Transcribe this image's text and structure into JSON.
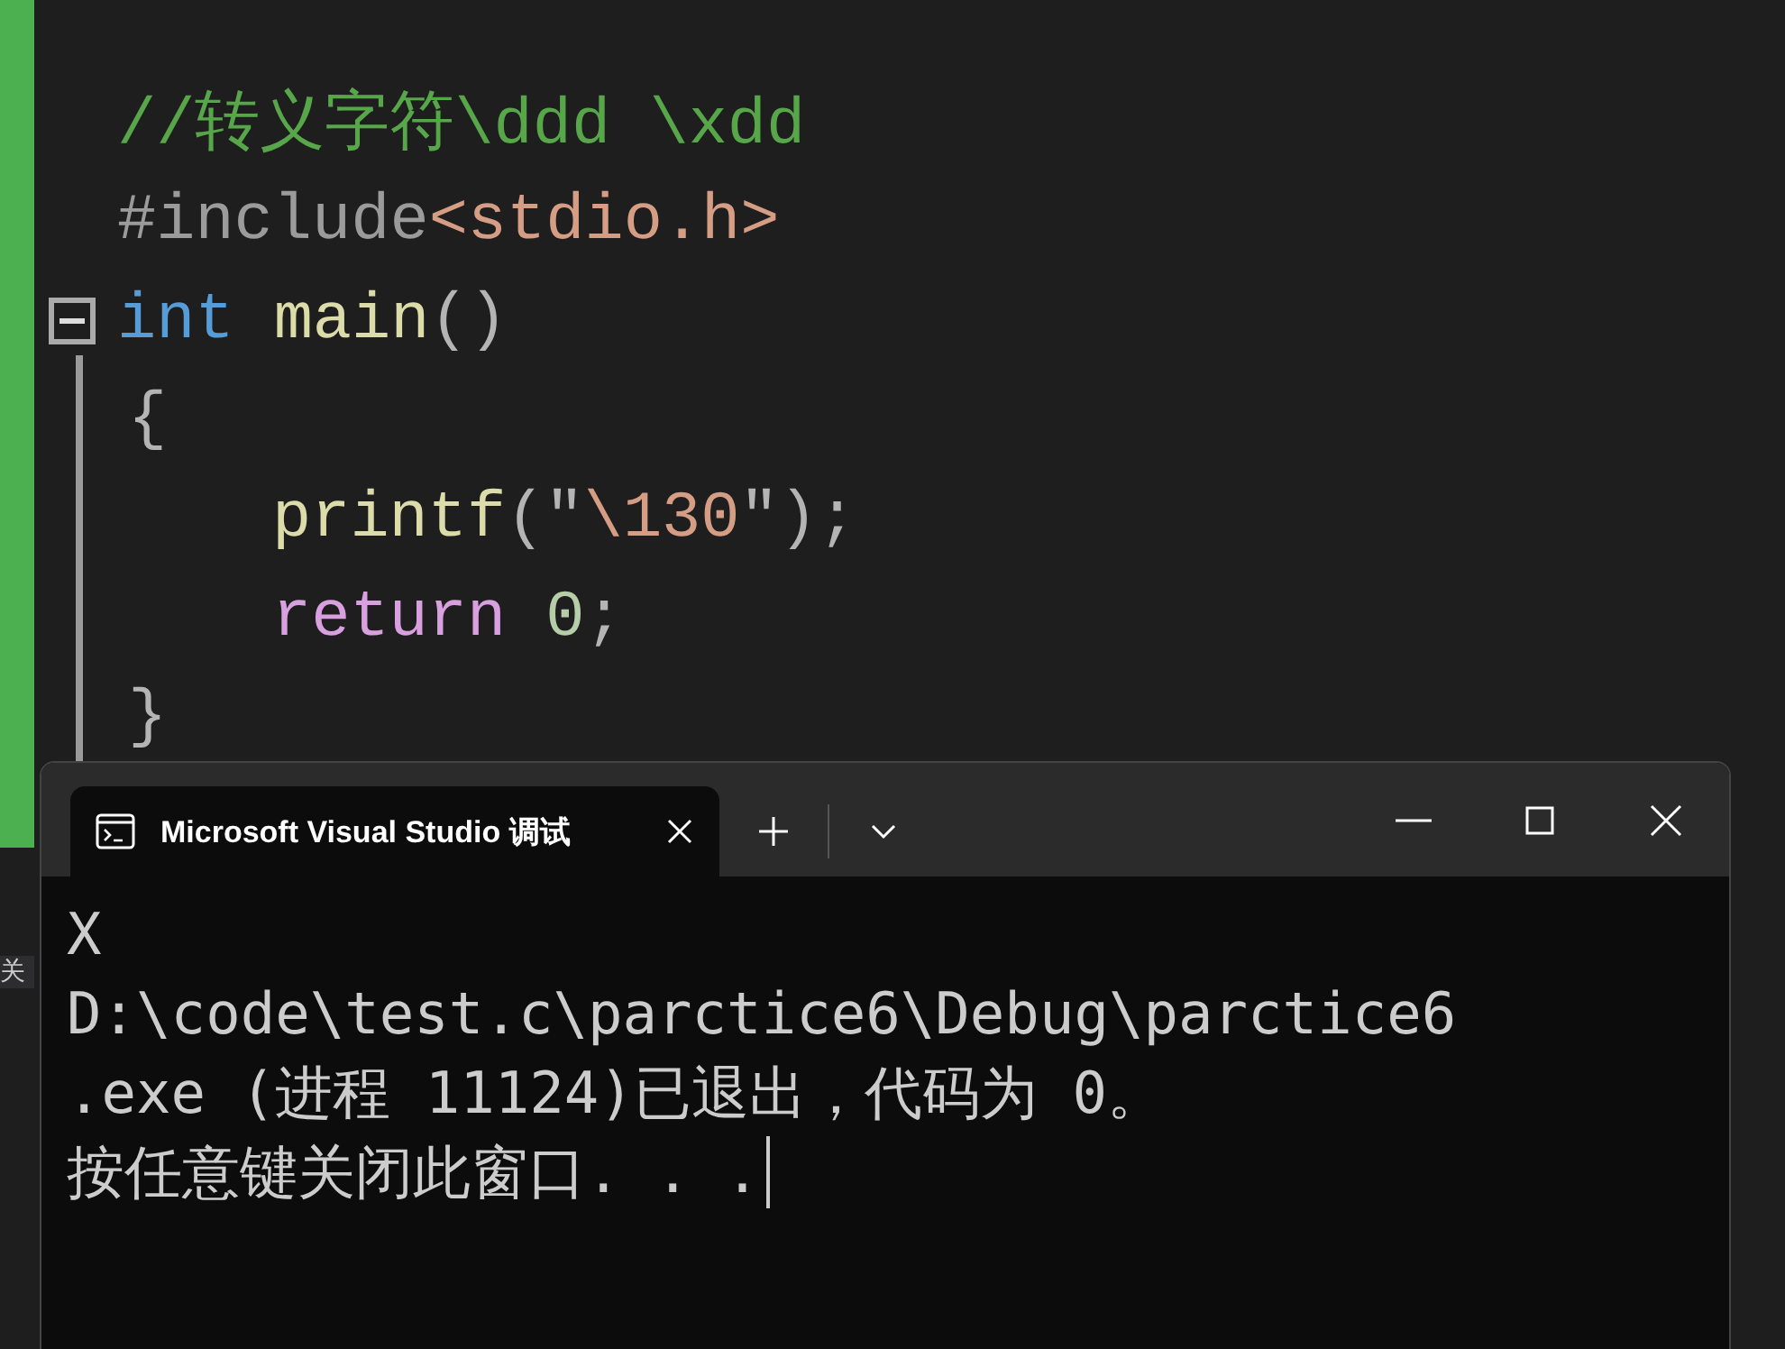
{
  "editor": {
    "lines": [
      {
        "kind": "plain",
        "tokens": [
          {
            "kind": "comment",
            "text": "//转义字符\\ddd \\xdd"
          }
        ]
      },
      {
        "kind": "plain",
        "tokens": [
          {
            "kind": "preproc",
            "text": "#include"
          },
          {
            "kind": "header",
            "text": "<stdio.h>"
          }
        ]
      },
      {
        "kind": "fold",
        "expanded": true,
        "tokens": [
          {
            "kind": "keyword",
            "text": "int"
          },
          {
            "kind": "function",
            "text": "main"
          },
          {
            "kind": "punct",
            "text": "()"
          }
        ]
      },
      {
        "kind": "brace",
        "tokens": [
          {
            "kind": "punct",
            "text": "{"
          }
        ]
      },
      {
        "kind": "body",
        "tokens": [
          {
            "kind": "function",
            "text": "printf"
          },
          {
            "kind": "punct",
            "text": "(\""
          },
          {
            "kind": "string",
            "text": "\\130"
          },
          {
            "kind": "punct",
            "text": "\");"
          }
        ]
      },
      {
        "kind": "body",
        "tokens": [
          {
            "kind": "control",
            "text": "return"
          },
          {
            "kind": "number",
            "text": "0"
          },
          {
            "kind": "punct",
            "text": ";"
          }
        ]
      },
      {
        "kind": "brace",
        "tokens": [
          {
            "kind": "punct",
            "text": "}"
          }
        ]
      }
    ],
    "side_label": "关"
  },
  "terminal": {
    "tabs": [
      {
        "title": "Microsoft Visual Studio 调试",
        "selected": true
      }
    ],
    "output": [
      "X",
      "D:\\code\\test.c\\parctice6\\Debug\\parctice6",
      ".exe (进程 11124)已退出，代码为 0。",
      "按任意键关闭此窗口. . ."
    ]
  }
}
